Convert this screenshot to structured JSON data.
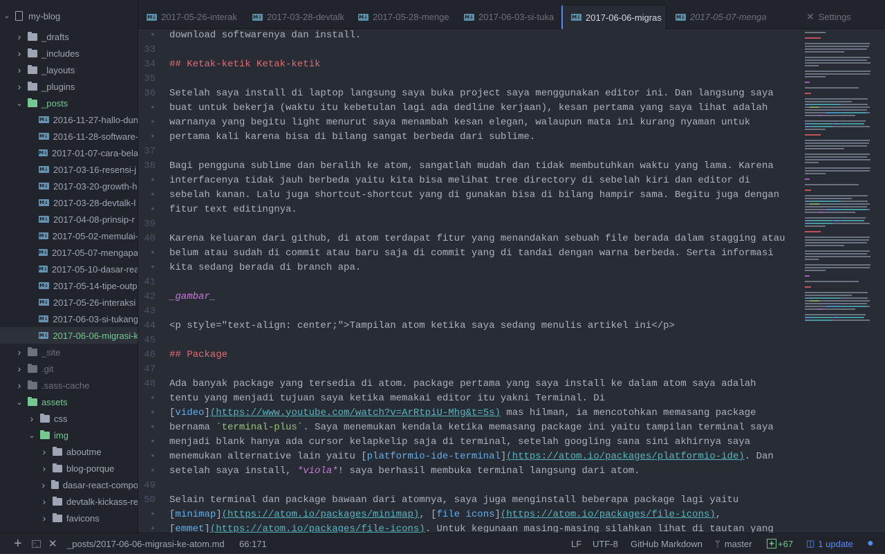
{
  "project": {
    "name": "my-blog",
    "icon": "repo-icon"
  },
  "tree": [
    {
      "label": "_drafts",
      "type": "folder",
      "level": 0,
      "state": "closed"
    },
    {
      "label": "_includes",
      "type": "folder",
      "level": 0,
      "state": "closed"
    },
    {
      "label": "_layouts",
      "type": "folder",
      "level": 0,
      "state": "closed"
    },
    {
      "label": "_plugins",
      "type": "folder",
      "level": 0,
      "state": "closed"
    },
    {
      "label": "_posts",
      "type": "folder",
      "level": 0,
      "state": "open",
      "status": "green"
    },
    {
      "label": "2016-11-27-hallo-dun",
      "type": "file",
      "level": 1
    },
    {
      "label": "2016-11-28-software-",
      "type": "file",
      "level": 1
    },
    {
      "label": "2017-01-07-cara-bela",
      "type": "file",
      "level": 1
    },
    {
      "label": "2017-03-16-resensi-j",
      "type": "file",
      "level": 1
    },
    {
      "label": "2017-03-20-growth-h",
      "type": "file",
      "level": 1
    },
    {
      "label": "2017-03-28-devtalk-l",
      "type": "file",
      "level": 1
    },
    {
      "label": "2017-04-08-prinsip-r",
      "type": "file",
      "level": 1
    },
    {
      "label": "2017-05-02-memulai-",
      "type": "file",
      "level": 1
    },
    {
      "label": "2017-05-07-mengapa",
      "type": "file",
      "level": 1
    },
    {
      "label": "2017-05-10-dasar-rea",
      "type": "file",
      "level": 1
    },
    {
      "label": "2017-05-14-tipe-outp",
      "type": "file",
      "level": 1
    },
    {
      "label": "2017-05-26-interaksi",
      "type": "file",
      "level": 1
    },
    {
      "label": "2017-06-03-si-tukang",
      "type": "file",
      "level": 1
    },
    {
      "label": "2017-06-06-migrasi-k",
      "type": "file",
      "level": 1,
      "status": "green",
      "selected": true
    },
    {
      "label": "_site",
      "type": "folder",
      "level": 0,
      "state": "closed",
      "status": "dim"
    },
    {
      "label": ".git",
      "type": "folder",
      "level": 0,
      "state": "closed",
      "status": "dim"
    },
    {
      "label": ".sass-cache",
      "type": "folder",
      "level": 0,
      "state": "closed",
      "status": "dim"
    },
    {
      "label": "assets",
      "type": "folder",
      "level": 0,
      "state": "open",
      "status": "green"
    },
    {
      "label": "css",
      "type": "folder",
      "level": 1,
      "state": "closed"
    },
    {
      "label": "img",
      "type": "folder",
      "level": 1,
      "state": "open",
      "status": "green"
    },
    {
      "label": "aboutme",
      "type": "folder",
      "level": 2,
      "state": "closed"
    },
    {
      "label": "blog-porque",
      "type": "folder",
      "level": 2,
      "state": "closed"
    },
    {
      "label": "dasar-react-compo",
      "type": "folder",
      "level": 2,
      "state": "closed"
    },
    {
      "label": "devtalk-kickass-re",
      "type": "folder",
      "level": 2,
      "state": "closed"
    },
    {
      "label": "favicons",
      "type": "folder",
      "level": 2,
      "state": "closed"
    }
  ],
  "tabs": [
    {
      "label": "2017-05-26-interak"
    },
    {
      "label": "2017-03-28-devtalk"
    },
    {
      "label": "2017-05-28-menge"
    },
    {
      "label": "2017-06-03-si-tuka"
    },
    {
      "label": "2017-06-06-migras",
      "active": true
    },
    {
      "label": "2017-05-07-menga",
      "pending": true
    }
  ],
  "settings_tab": {
    "label": "Settings",
    "icon": "tools-icon"
  },
  "editor": {
    "lines": [
      {
        "n": "•",
        "s": [
          [
            "download softwarenya dan install.",
            "t"
          ]
        ]
      },
      {
        "n": "33",
        "s": []
      },
      {
        "n": "34",
        "s": [
          [
            "## Ketak-ketik Ketak-ketik",
            "heading"
          ]
        ]
      },
      {
        "n": "35",
        "s": []
      },
      {
        "n": "36",
        "s": [
          [
            "Setelah saya install di laptop langsung saya buka project saya menggunakan editor ini. Dan langsung saya",
            "t"
          ]
        ]
      },
      {
        "n": "•",
        "s": [
          [
            "buat untuk bekerja (waktu itu kebetulan lagi ada dedline kerjaan), kesan pertama yang saya lihat adalah",
            "t"
          ]
        ]
      },
      {
        "n": "•",
        "s": [
          [
            "warnanya yang begitu light menurut saya menambah kesan elegan, walaupun mata ini kurang nyaman untuk",
            "t"
          ]
        ]
      },
      {
        "n": "•",
        "s": [
          [
            "pertama kali karena bisa di bilang sangat berbeda dari sublime.",
            "t"
          ]
        ]
      },
      {
        "n": "37",
        "s": []
      },
      {
        "n": "38",
        "s": [
          [
            "Bagi pengguna sublime dan beralih ke atom, sangatlah mudah dan tidak membutuhkan waktu yang lama. Karena",
            "t"
          ]
        ]
      },
      {
        "n": "•",
        "s": [
          [
            "interfacenya tidak jauh berbeda yaitu kita bisa melihat tree directory di sebelah kiri dan editor di",
            "t"
          ]
        ]
      },
      {
        "n": "•",
        "s": [
          [
            "sebelah kanan. Lalu juga shortcut-shortcut yang di gunakan bisa di bilang hampir sama. Begitu juga dengan",
            "t"
          ]
        ]
      },
      {
        "n": "•",
        "s": [
          [
            "fitur text editingnya.",
            "t"
          ]
        ]
      },
      {
        "n": "39",
        "s": []
      },
      {
        "n": "40",
        "s": [
          [
            "Karena keluaran dari github, di atom terdapat fitur yang menandakan sebuah file berada dalam stagging atau",
            "t"
          ]
        ]
      },
      {
        "n": "•",
        "s": [
          [
            "belum atau sudah di commit atau baru saja di commit yang di tandai dengan warna berbeda. Serta informasi",
            "t"
          ]
        ]
      },
      {
        "n": "•",
        "s": [
          [
            "kita sedang berada di branch apa.",
            "t"
          ]
        ]
      },
      {
        "n": "41",
        "s": []
      },
      {
        "n": "42",
        "s": [
          [
            "_gambar_",
            "italic"
          ]
        ]
      },
      {
        "n": "43",
        "s": []
      },
      {
        "n": "44",
        "s": [
          [
            "<p style=\"text-align: center;\">Tampilan atom ketika saya sedang menulis artikel ini</p>",
            "t"
          ]
        ]
      },
      {
        "n": "45",
        "s": []
      },
      {
        "n": "46",
        "s": [
          [
            "## Package",
            "heading"
          ]
        ]
      },
      {
        "n": "47",
        "s": []
      },
      {
        "n": "48",
        "s": [
          [
            "Ada banyak package yang tersedia di atom. package pertama yang saya install ke dalam atom saya adalah",
            "t"
          ]
        ]
      },
      {
        "n": "•",
        "s": [
          [
            "tentu yang menjadi tujuan saya ketika memakai editor itu yakni Terminal. Di",
            "t"
          ]
        ]
      },
      {
        "n": "•",
        "s": [
          [
            "[",
            "t"
          ],
          [
            "video",
            "linktext"
          ],
          [
            "]",
            "t"
          ],
          [
            "(https://www.youtube.com/watch?v=ArRtpiU-Mhg&t=5s)",
            "url"
          ],
          [
            " mas hilman, ia mencotohkan memasang package",
            "t"
          ]
        ]
      },
      {
        "n": "•",
        "s": [
          [
            "bernama ",
            "t"
          ],
          [
            "`terminal-plus`",
            "code"
          ],
          [
            ". Saya menemukan kendala ketika memasang package ini yaitu tampilan terminal saya",
            "t"
          ]
        ]
      },
      {
        "n": "•",
        "s": [
          [
            "menjadi blank hanya ada cursor kelapkelip saja di terminal, setelah googling sana sini akhirnya saya",
            "t"
          ]
        ]
      },
      {
        "n": "•",
        "s": [
          [
            "menemukan alternative lain yaitu [",
            "t"
          ],
          [
            "platformio-ide-terminal",
            "linktext"
          ],
          [
            "]",
            "t"
          ],
          [
            "(https://atom.io/packages/platformio-ide)",
            "url"
          ],
          [
            ". Dan",
            "t"
          ]
        ]
      },
      {
        "n": "•",
        "s": [
          [
            "setelah saya install, ",
            "t"
          ],
          [
            "*viola*",
            "italic"
          ],
          [
            "! saya berhasil membuka terminal langsung dari atom.",
            "t"
          ]
        ]
      },
      {
        "n": "49",
        "s": []
      },
      {
        "n": "50",
        "s": [
          [
            "Selain terminal dan package bawaan dari atomnya, saya juga menginstall beberapa package lagi yaitu",
            "t"
          ]
        ]
      },
      {
        "n": "•",
        "s": [
          [
            "[",
            "t"
          ],
          [
            "minimap",
            "linktext"
          ],
          [
            "]",
            "t"
          ],
          [
            "(https://atom.io/packages/minimap)",
            "url"
          ],
          [
            ", [",
            "t"
          ],
          [
            "file icons",
            "linktext"
          ],
          [
            "]",
            "t"
          ],
          [
            "(https://atom.io/packages/file-icons)",
            "url"
          ],
          [
            ",",
            "t"
          ]
        ]
      },
      {
        "n": "•",
        "s": [
          [
            "[",
            "t"
          ],
          [
            "emmet",
            "linktext"
          ],
          [
            "]",
            "t"
          ],
          [
            "(https://atom.io/packages/file-icons)",
            "url"
          ],
          [
            ". Untuk kegunaan masing-masing silahkan lihat di tautan yang",
            "t"
          ]
        ]
      }
    ]
  },
  "status": {
    "file_path": "_posts/2017-06-06-migrasi-ke-atom.md",
    "cursor": "66:171",
    "line_ending": "LF",
    "encoding": "UTF-8",
    "grammar": "GitHub Markdown",
    "branch": "master",
    "diff": "+67",
    "updates": "1 update"
  },
  "colors": {
    "accent": "#568af2",
    "git_added": "#73c990",
    "heading": "#e06c75",
    "link": "#61afef",
    "url": "#56b6c2",
    "code": "#98c379",
    "italic": "#c678dd",
    "text": "#abb2bf"
  }
}
